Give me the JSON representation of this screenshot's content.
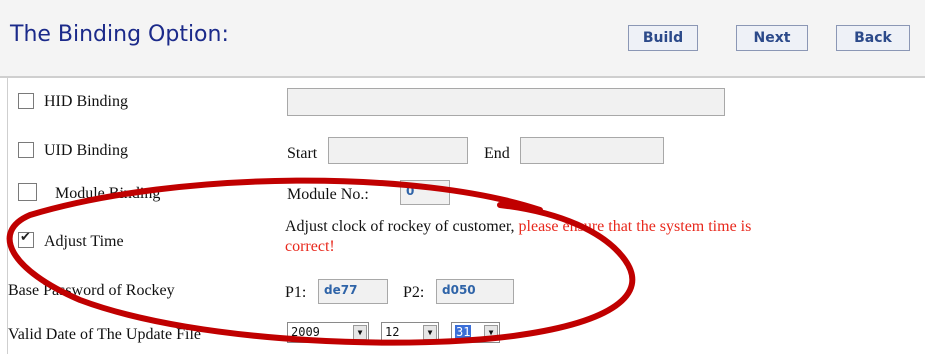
{
  "header": {
    "title": "The Binding Option:",
    "build_label": "Build",
    "next_label": "Next",
    "back_label": "Back"
  },
  "hid": {
    "label": "HID Binding",
    "checked": false,
    "value": ""
  },
  "uid": {
    "label": "UID Binding",
    "checked": false,
    "start_label": "Start",
    "end_label": "End",
    "start_value": "",
    "end_value": ""
  },
  "module": {
    "label": "Module Binding",
    "checked": false,
    "no_label": "Module No.:",
    "no_value": "0"
  },
  "adjust": {
    "label": "Adjust Time",
    "checked": true,
    "desc_black": "Adjust clock of rockey of customer,",
    "desc_red_1": " please ensure that the system time is",
    "desc_red_2": "correct!"
  },
  "password": {
    "label": "Base Password of Rockey",
    "p1_label": "P1:",
    "p1_value": "de77",
    "p2_label": "P2:",
    "p2_value": "d050"
  },
  "valid_date": {
    "label": "Valid Date of The Update File",
    "year": "2009",
    "month": "12",
    "day": "31"
  },
  "colors": {
    "title": "#1b2a8a",
    "button_text": "#2c4a8a",
    "red": "#e8281c",
    "annotation": "#c00000",
    "input_text": "#2f64a8"
  },
  "icons": {
    "dropdown": "chevron-down-icon",
    "checkbox_mark": "checkmark-icon"
  }
}
